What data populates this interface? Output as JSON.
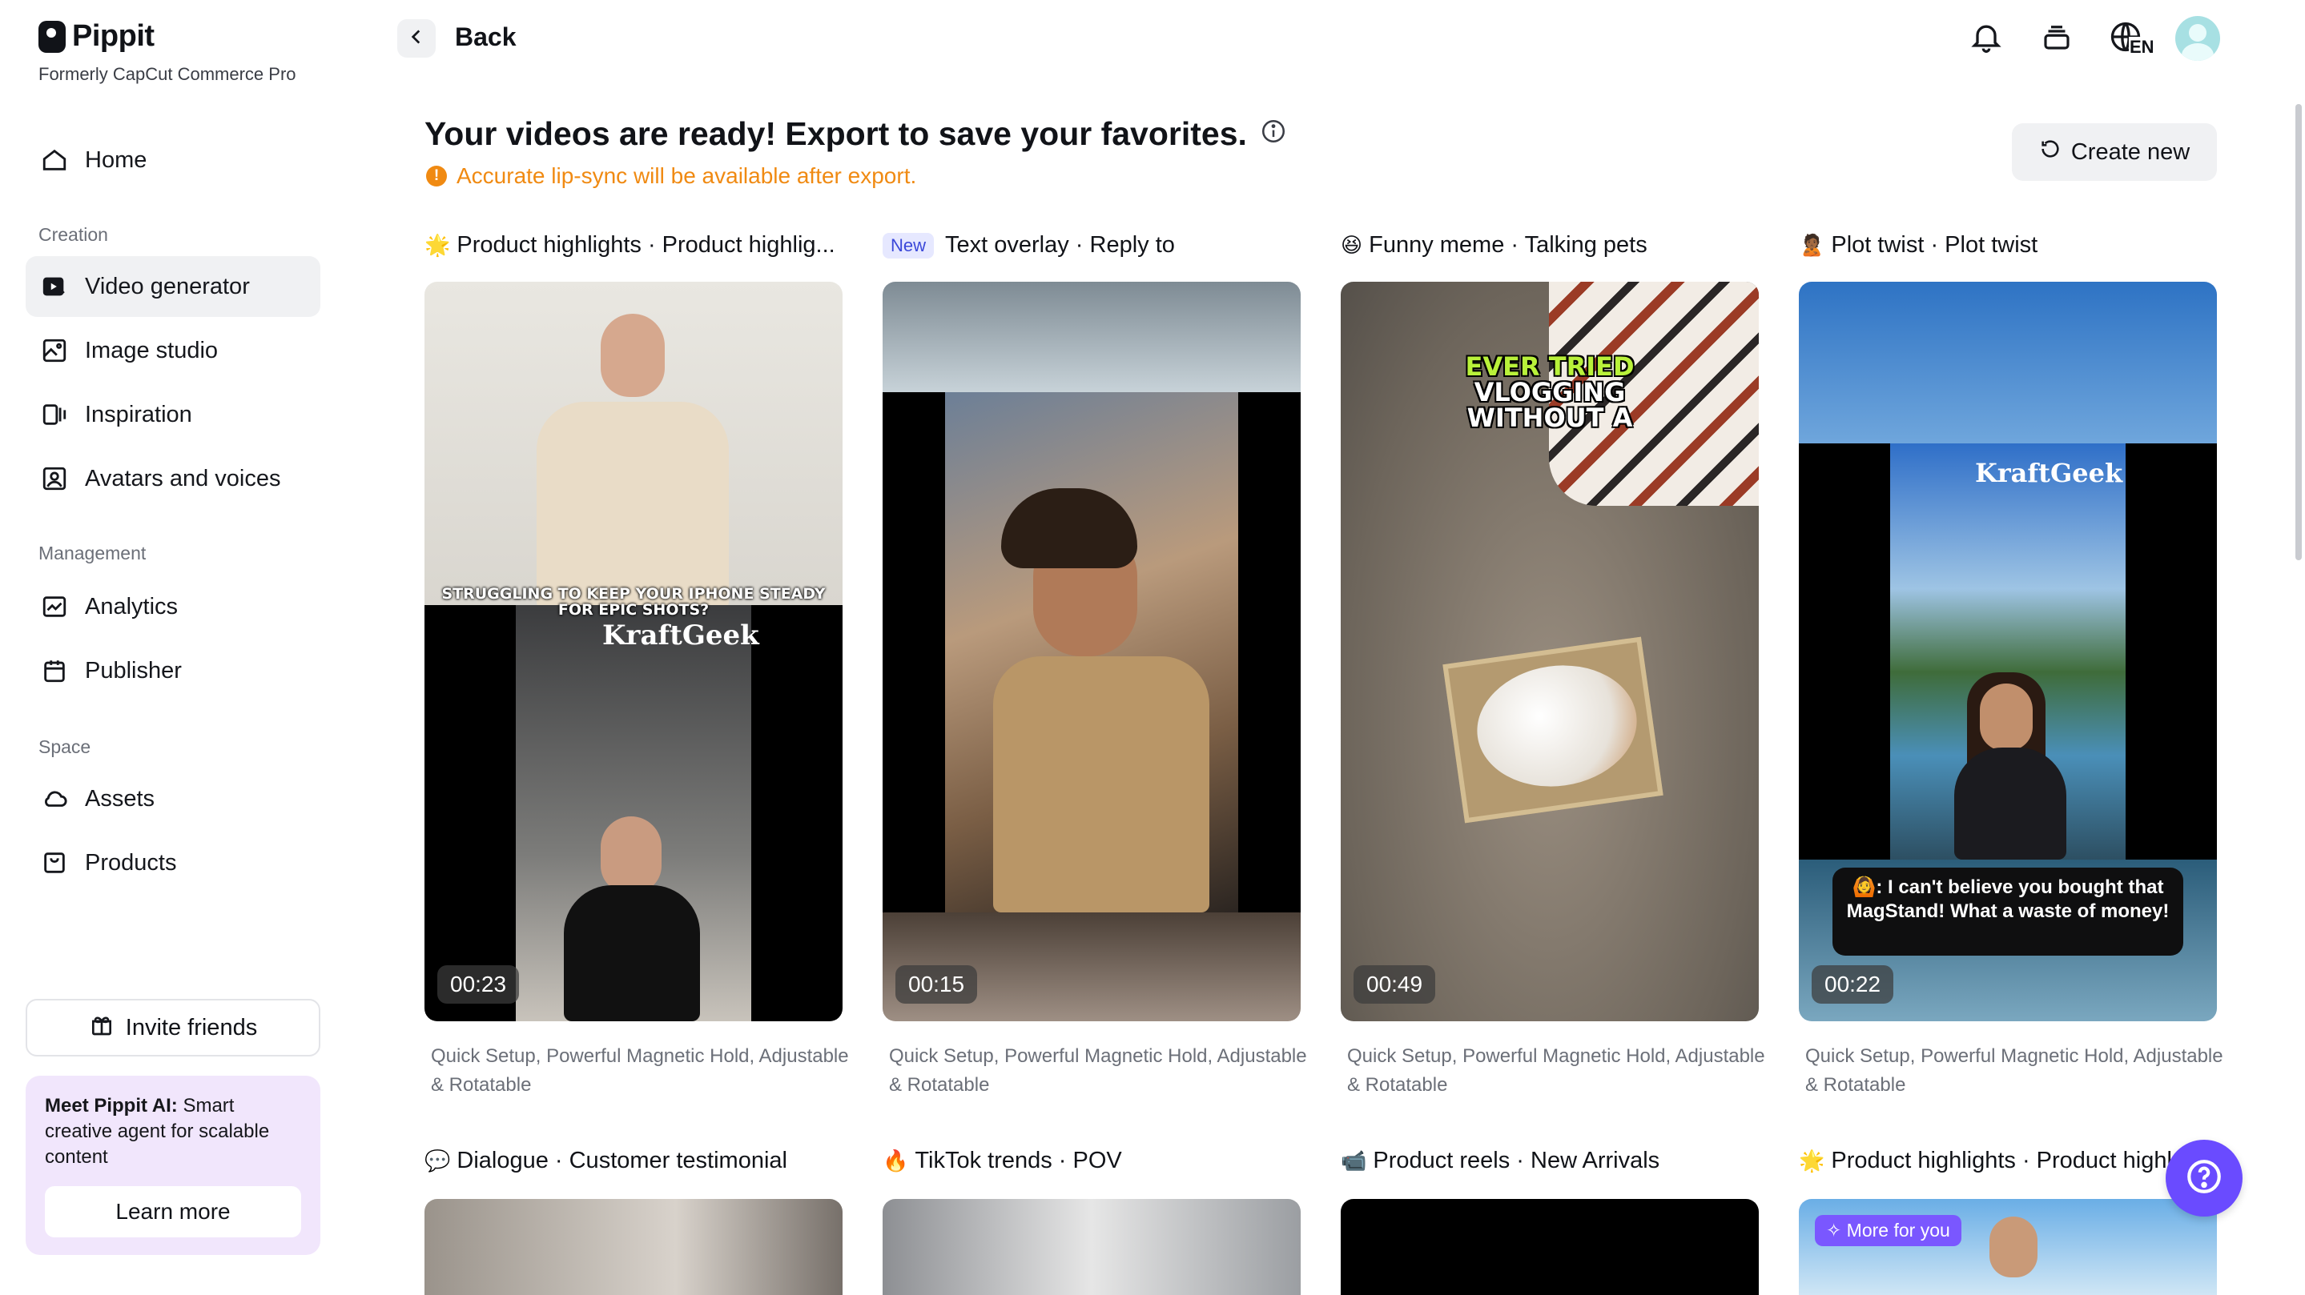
{
  "brand": {
    "name": "Pippit",
    "subtitle": "Formerly CapCut Commerce Pro"
  },
  "sidebar": {
    "home": "Home",
    "sections": {
      "creation": "Creation",
      "management": "Management",
      "space": "Space"
    },
    "creation_items": [
      "Video generator",
      "Image studio",
      "Inspiration",
      "Avatars and voices"
    ],
    "management_items": [
      "Analytics",
      "Publisher"
    ],
    "space_items": [
      "Assets",
      "Products"
    ],
    "active_item": "Video generator",
    "invite": "Invite friends",
    "promo": {
      "bold": "Meet Pippit AI:",
      "text": " Smart creative agent for scalable content",
      "button": "Learn more"
    }
  },
  "header": {
    "back": "Back",
    "language": "EN"
  },
  "main": {
    "headline": "Your videos are ready! Export to save your favorites.",
    "notice": "Accurate lip-sync will be available after export.",
    "create_new": "Create new",
    "cards": [
      {
        "emoji": "🌟",
        "badge": "",
        "title": "Product highlights · Product highlig...",
        "duration": "00:23",
        "desc": "Quick Setup, Powerful Magnetic Hold, Adjustable & Rotatable",
        "overlay": "STRUGGLING TO KEEP YOUR IPHONE STEADY FOR EPIC SHOTS?",
        "watermark": "KraftGeek"
      },
      {
        "emoji": "",
        "badge": "New",
        "title": "Text overlay · Reply to",
        "duration": "00:15",
        "desc": "Quick Setup, Powerful Magnetic Hold, Adjustable & Rotatable"
      },
      {
        "emoji": "😆",
        "badge": "",
        "title": "Funny meme · Talking pets",
        "duration": "00:49",
        "desc": "Quick Setup, Powerful Magnetic Hold, Adjustable & Rotatable",
        "overlay_1": "EVER TRIED",
        "overlay_2": "VLOGGING",
        "overlay_3": "WITHOUT A"
      },
      {
        "emoji": "🙎🏾",
        "badge": "",
        "title": "Plot twist · Plot twist",
        "duration": "00:22",
        "desc": "Quick Setup, Powerful Magnetic Hold, Adjustable & Rotatable",
        "watermark": "KraftGeek",
        "speech": "🙆: I can't believe you bought that MagStand! What a waste of money!"
      }
    ],
    "row2": [
      {
        "emoji": "💬",
        "title": "Dialogue · Customer testimonial"
      },
      {
        "emoji": "🔥",
        "title": "TikTok trends · POV"
      },
      {
        "emoji": "📹",
        "title": "Product reels · New Arrivals"
      },
      {
        "emoji": "🌟",
        "title": "Product highlights · Product highl...",
        "tag": "More for you"
      }
    ]
  },
  "colors": {
    "accent": "#6a4bff",
    "warning": "#f08a12",
    "promo_bg": "#f1e6fc",
    "active_bg": "#f0f1f3"
  },
  "icons": [
    "home-icon",
    "video-generator-icon",
    "image-studio-icon",
    "inspiration-icon",
    "avatars-icon",
    "analytics-icon",
    "publisher-icon",
    "assets-icon",
    "products-icon",
    "gift-icon",
    "bell-icon",
    "stack-icon",
    "globe-icon",
    "refresh-icon",
    "help-icon",
    "info-icon"
  ]
}
